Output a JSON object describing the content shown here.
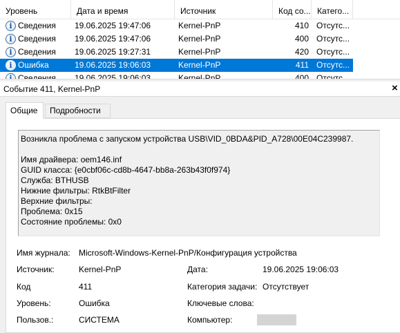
{
  "list": {
    "columns": [
      "Уровень",
      "Дата и время",
      "Источник",
      "Код со...",
      "Катего..."
    ],
    "rows": [
      {
        "level": "Сведения",
        "icon": "info-icon",
        "datetime": "19.06.2025 19:47:06",
        "source": "Kernel-PnP",
        "code": "410",
        "category": "Отсутс...",
        "selected": false
      },
      {
        "level": "Сведения",
        "icon": "info-icon",
        "datetime": "19.06.2025 19:47:06",
        "source": "Kernel-PnP",
        "code": "400",
        "category": "Отсутс...",
        "selected": false
      },
      {
        "level": "Сведения",
        "icon": "info-icon",
        "datetime": "19.06.2025 19:27:31",
        "source": "Kernel-PnP",
        "code": "420",
        "category": "Отсутс...",
        "selected": false
      },
      {
        "level": "Ошибка",
        "icon": "info-icon",
        "datetime": "19.06.2025 19:06:03",
        "source": "Kernel-PnP",
        "code": "411",
        "category": "Отсутс...",
        "selected": true
      },
      {
        "level": "Сведения",
        "icon": "info-icon",
        "datetime": "19.06.2025 19:06:03",
        "source": "Kernel-PnP",
        "code": "400",
        "category": "Отсутс...",
        "selected": false
      }
    ]
  },
  "details": {
    "title": "Событие 411, Kernel-PnP",
    "close_glyph": "×",
    "tabs": [
      "Общие",
      "Подробности"
    ],
    "description_lines": [
      "Возникла проблема с запуском устройства USB\\VID_0BDA&PID_A728\\00E04C239987.",
      "",
      "Имя драйвера: oem146.inf",
      "GUID класса: {e0cbf06c-cd8b-4647-bb8a-263b43f0f974}",
      "Служба: BTHUSB",
      "Нижние фильтры: RtkBtFilter",
      "Верхние фильтры:",
      "Проблема: 0x15",
      "Состояние проблемы: 0x0"
    ],
    "fields": {
      "log_name_label": "Имя журнала:",
      "log_name_value": "Microsoft-Windows-Kernel-PnP/Конфигурация устройства",
      "source_label": "Источник:",
      "source_value": "Kernel-PnP",
      "date_label": "Дата:",
      "date_value": "19.06.2025 19:06:03",
      "code_label": "Код",
      "code_value": "411",
      "task_label": "Категория задачи:",
      "task_value": "Отсутствует",
      "level_label": "Уровень:",
      "level_value": "Ошибка",
      "keywords_label": "Ключевые слова:",
      "user_label": "Пользов.:",
      "user_value": "СИСТЕМА",
      "computer_label": "Компьютер:"
    }
  },
  "colors": {
    "selection": "#0078d7",
    "pane_bg": "#f0f0f0"
  }
}
